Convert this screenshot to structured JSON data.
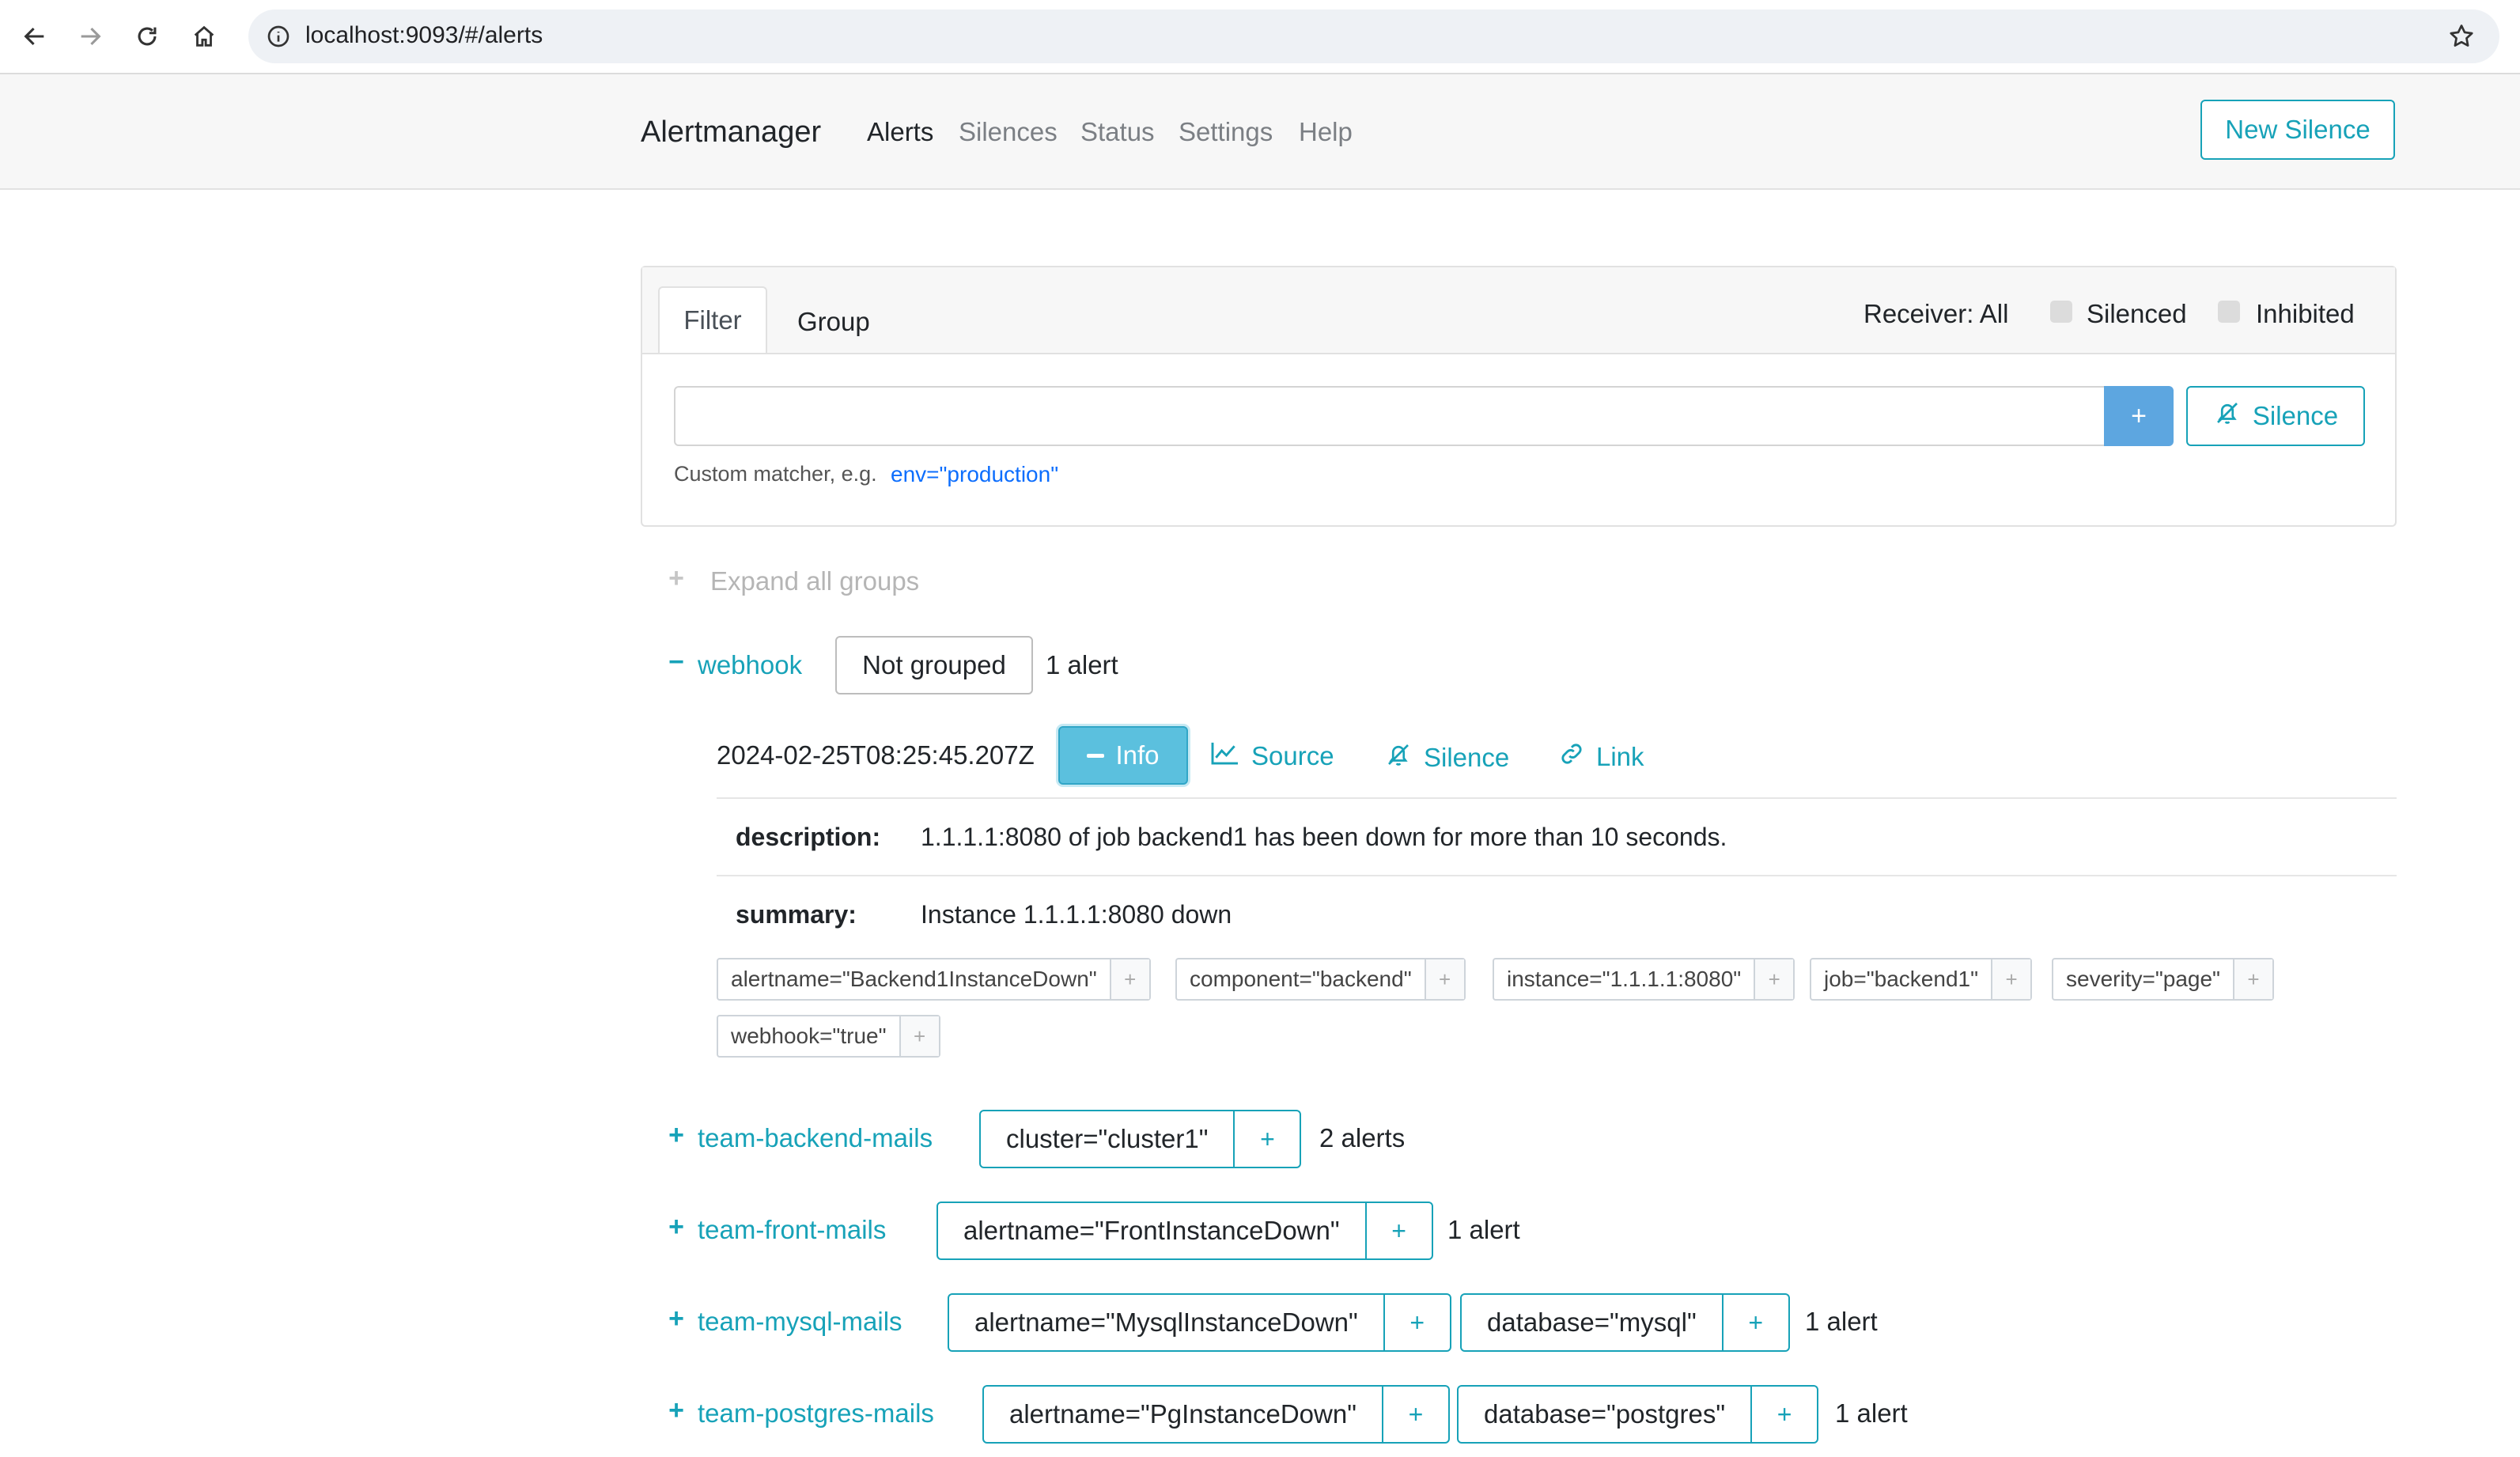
{
  "browser": {
    "url": "localhost:9093/#/alerts"
  },
  "header": {
    "brand": "Alertmanager",
    "nav": [
      "Alerts",
      "Silences",
      "Status",
      "Settings",
      "Help"
    ],
    "new_silence": "New Silence"
  },
  "filter": {
    "tabs": [
      "Filter",
      "Group"
    ],
    "receiver": "Receiver: All",
    "silenced": "Silenced",
    "inhibited": "Inhibited",
    "input_value": "",
    "plus": "+",
    "silence_button": "Silence",
    "hint": "Custom matcher, e.g.",
    "hint_example": "env=\"production\""
  },
  "expand_all": "Expand all groups",
  "groups": [
    {
      "name": "webhook",
      "grouping": "Not grouped",
      "count": "1 alert",
      "alert": {
        "timestamp": "2024-02-25T08:25:45.207Z",
        "actions": {
          "info": "Info",
          "source": "Source",
          "silence": "Silence",
          "link": "Link"
        },
        "annotations": [
          {
            "key": "description:",
            "value": "1.1.1.1:8080 of job backend1 has been down for more than 10 seconds."
          },
          {
            "key": "summary:",
            "value": "Instance 1.1.1.1:8080 down"
          }
        ],
        "labels": [
          "alertname=\"Backend1InstanceDown\"",
          "component=\"backend\"",
          "instance=\"1.1.1.1:8080\"",
          "job=\"backend1\"",
          "severity=\"page\"",
          "webhook=\"true\""
        ]
      }
    },
    {
      "name": "team-backend-mails",
      "labels": [
        "cluster=\"cluster1\""
      ],
      "count": "2 alerts"
    },
    {
      "name": "team-front-mails",
      "labels": [
        "alertname=\"FrontInstanceDown\""
      ],
      "count": "1 alert"
    },
    {
      "name": "team-mysql-mails",
      "labels": [
        "alertname=\"MysqlInstanceDown\"",
        "database=\"mysql\""
      ],
      "count": "1 alert"
    },
    {
      "name": "team-postgres-mails",
      "labels": [
        "alertname=\"PgInstanceDown\"",
        "database=\"postgres\""
      ],
      "count": "1 alert"
    }
  ],
  "colors": {
    "accent": "#17a2b8",
    "info_button": "#5bc0de",
    "plus_button": "#5da6e0"
  }
}
